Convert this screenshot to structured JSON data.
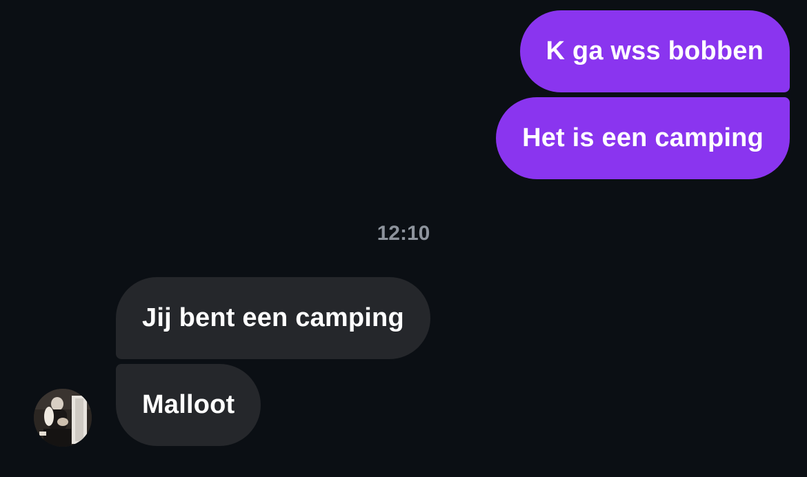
{
  "conversation": {
    "outgoing": [
      {
        "text": "K ga wss bobben"
      },
      {
        "text": "Het is een camping"
      }
    ],
    "timestamp": "12:10",
    "incoming": [
      {
        "text": "Jij bent een camping"
      },
      {
        "text": "Malloot"
      }
    ],
    "contact_avatar_icon": "contact-photo"
  },
  "colors": {
    "background": "#0b0f14",
    "outgoing_bubble": "#8a35ef",
    "incoming_bubble": "#25272b",
    "timestamp_text": "#8d939c"
  }
}
